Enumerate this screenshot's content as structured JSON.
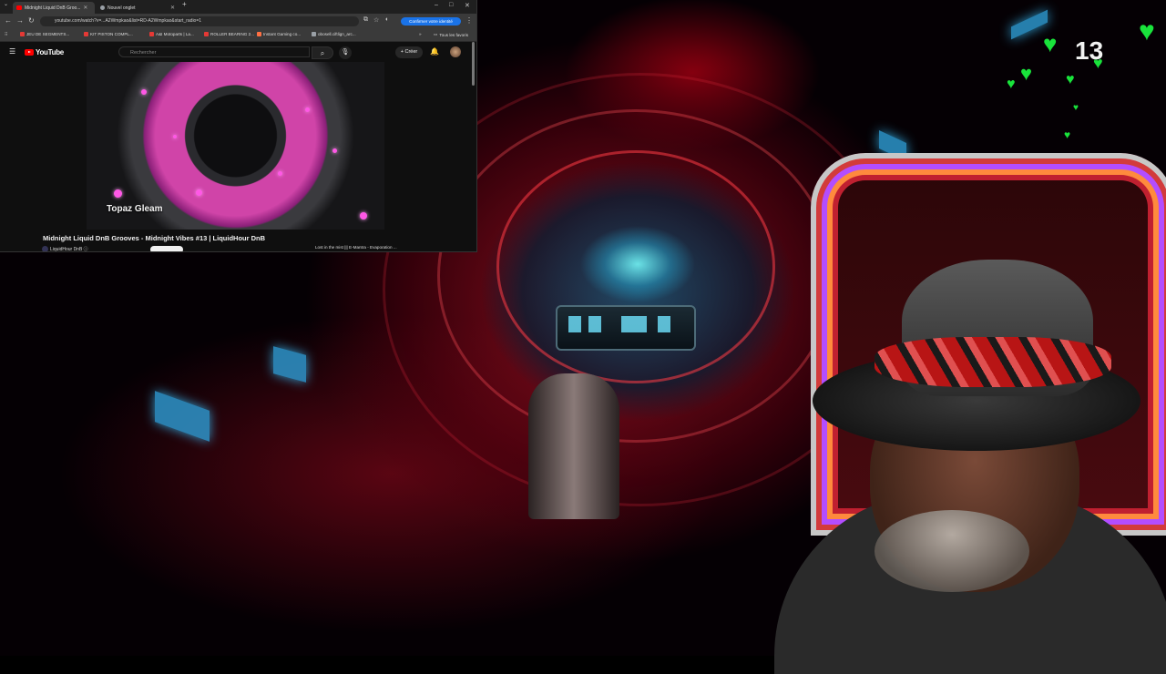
{
  "browser": {
    "tabs": [
      {
        "label": "Midnight Liquid DnB Groo...",
        "active": true
      },
      {
        "label": "Nouvel onglet",
        "active": false
      }
    ],
    "window_controls": [
      "–",
      "□",
      "✕"
    ],
    "url": "youtube.com/watch?v=...A2Wmpkao&list=RD-A2Wmpkao&start_radio=1",
    "confirm_identity": "Confirmer votre identité",
    "bookmarks": [
      {
        "label": "JEU DE SEGMENTS...",
        "color": "#e53935"
      },
      {
        "label": "KIT PISTON COMPL...",
        "color": "#e53935"
      },
      {
        "label": "A&I Motoparts | La...",
        "color": "#e53935"
      },
      {
        "label": "ROLLER BEARING 2...",
        "color": "#e53935"
      },
      {
        "label": "Instant Gaming co...",
        "color": "#ff7043"
      },
      {
        "label": "obosell.ciftlign_arc...",
        "color": "#9aa0a6"
      }
    ],
    "all_favorites": "Tous les favoris"
  },
  "youtube": {
    "logo": "YouTube",
    "search_placeholder": "Rechercher",
    "create_label": "Créer",
    "video_caption": "Topaz Gleam",
    "video_title": "Midnight Liquid DnB Grooves - Midnight Vibes #13 | LiquidHour DnB",
    "channel": "LiquidHour DnB ⓘ",
    "playlist_next": "Lost in the mist ||| E-Mantra - Evaporation ..."
  },
  "overlay": {
    "badge_number": "13",
    "heart_color": "#19e33b"
  }
}
